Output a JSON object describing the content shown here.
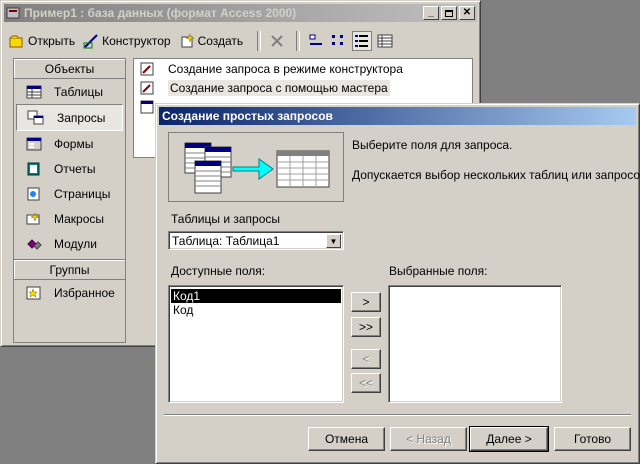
{
  "main_window": {
    "title": "Пример1 : база данных (формат Access 2000)",
    "toolbar": {
      "open_label": "Открыть",
      "design_label": "Конструктор",
      "create_label": "Создать"
    },
    "objects_header": "Объекты",
    "objects": [
      {
        "label": "Таблицы",
        "icon": "table-icon"
      },
      {
        "label": "Запросы",
        "icon": "query-icon"
      },
      {
        "label": "Формы",
        "icon": "form-icon"
      },
      {
        "label": "Отчеты",
        "icon": "report-icon"
      },
      {
        "label": "Страницы",
        "icon": "page-icon"
      },
      {
        "label": "Макросы",
        "icon": "macro-icon"
      },
      {
        "label": "Модули",
        "icon": "module-icon"
      }
    ],
    "groups_header": "Группы",
    "groups": [
      {
        "label": "Избранное",
        "icon": "favorites-icon"
      }
    ],
    "list_items": [
      "Создание запроса в режиме конструктора",
      "Создание запроса с помощью мастера"
    ]
  },
  "dialog": {
    "title": "Создание простых запросов",
    "instruction": "Выберите поля для запроса.",
    "hint": "Допускается выбор нескольких таблиц или запросов.",
    "tables_label": "Таблицы и запросы",
    "tables_value": "Таблица: Таблица1",
    "available_label": "Доступные поля:",
    "selected_label": "Выбранные поля:",
    "available_fields": [
      "Код1",
      "Код"
    ],
    "move_one": ">",
    "move_all": ">>",
    "remove_one": "<",
    "remove_all": "<<",
    "cancel": "Отмена",
    "back": "< Назад",
    "next": "Далее >",
    "finish": "Готово"
  },
  "colors": {
    "face": "#d4d0c8",
    "title_active": "#0a246a",
    "title_inactive": "#808080",
    "desktop": "#808080"
  }
}
